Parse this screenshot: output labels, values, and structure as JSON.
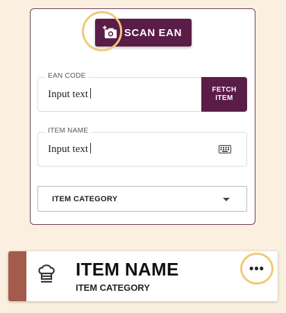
{
  "scan": {
    "label": "SCAN EAN",
    "icon": "add-photo-camera-icon"
  },
  "ean_field": {
    "label": "EAN CODE",
    "value": "Input text",
    "fetch_label_line1": "FETCH",
    "fetch_label_line2": "ITEM"
  },
  "name_field": {
    "label": "ITEM NAME",
    "value": "Input text",
    "icon": "keyboard-icon"
  },
  "category_select": {
    "label": "ITEM CATEGORY"
  },
  "item_card": {
    "title": "ITEM NAME",
    "subtitle": "ITEM CATEGORY",
    "icon": "chef-hat-icon",
    "more_label": "•••"
  },
  "colors": {
    "background": "#fbf0df",
    "brand": "#5a1d47",
    "highlight": "#f1c877",
    "stripe": "#a35c4c"
  }
}
